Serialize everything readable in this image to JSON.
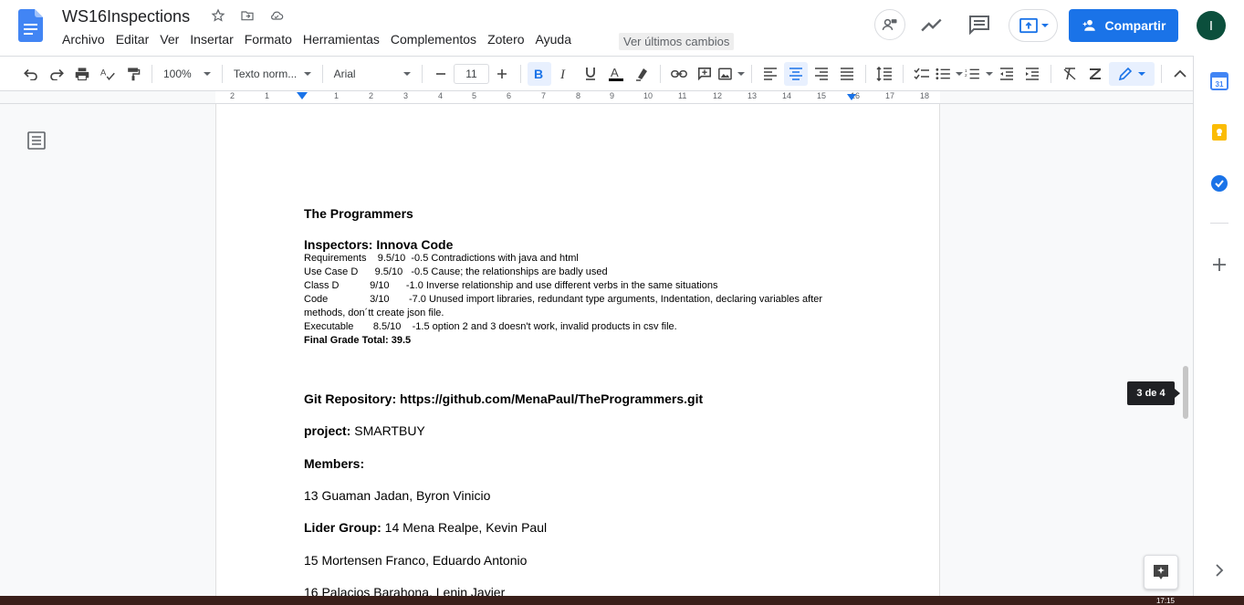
{
  "app": {
    "doc_title": "WS16Inspections",
    "menu": [
      "Archivo",
      "Editar",
      "Ver",
      "Insertar",
      "Formato",
      "Herramientas",
      "Complementos",
      "Zotero",
      "Ayuda"
    ],
    "last_changes": "Ver últimos cambios",
    "share_label": "Compartir",
    "avatar_letter": "I",
    "brand_color": "#1a73e8"
  },
  "toolbar": {
    "zoom": "100%",
    "style": "Texto norm...",
    "font": "Arial",
    "font_size": "11"
  },
  "ruler": {
    "ticks": [
      "2",
      "1",
      "1",
      "2",
      "3",
      "4",
      "5",
      "6",
      "7",
      "8",
      "9",
      "10",
      "11",
      "12",
      "13",
      "14",
      "15",
      "16",
      "17",
      "18"
    ]
  },
  "document": {
    "team_title": "The Programmers",
    "inspectors_line": "Inspectors: Innova Code",
    "grades": [
      "Requirements    9.5/10  -0.5 Contradictions with java and html",
      "Use Case D      9.5/10   -0.5 Cause; the relationships are badly used",
      "Class D           9/10      -1.0 Inverse relationship and use different verbs in the same situations",
      "Code               3/10       -7.0 Unused import libraries, redundant type arguments, Indentation, declaring variables after",
      "methods, don´tt create json file.",
      "Executable       8.5/10    -1.5 option 2 and 3 doesn't work, invalid products in csv file."
    ],
    "final_grade": "Final Grade Total: 39.5",
    "git_label": "Git Repository: https://github.com/MenaPaul/TheProgrammers.git",
    "project_label": "project:",
    "project_value": " SMARTBUY",
    "members_label": "Members:",
    "member_1": "13 Guaman Jadan, Byron Vinicio",
    "leader_label": "Lider Group:",
    "leader_value": " 14 Mena Realpe, Kevin Paul",
    "member_3": "15 Mortensen Franco, Eduardo Antonio",
    "member_4": "16 Palacios Barahona, Lenin Javier"
  },
  "page_indicator": "3 de 4",
  "side_panel": {
    "calendar_day": "31"
  },
  "taskbar": {
    "clock": "17:15"
  }
}
